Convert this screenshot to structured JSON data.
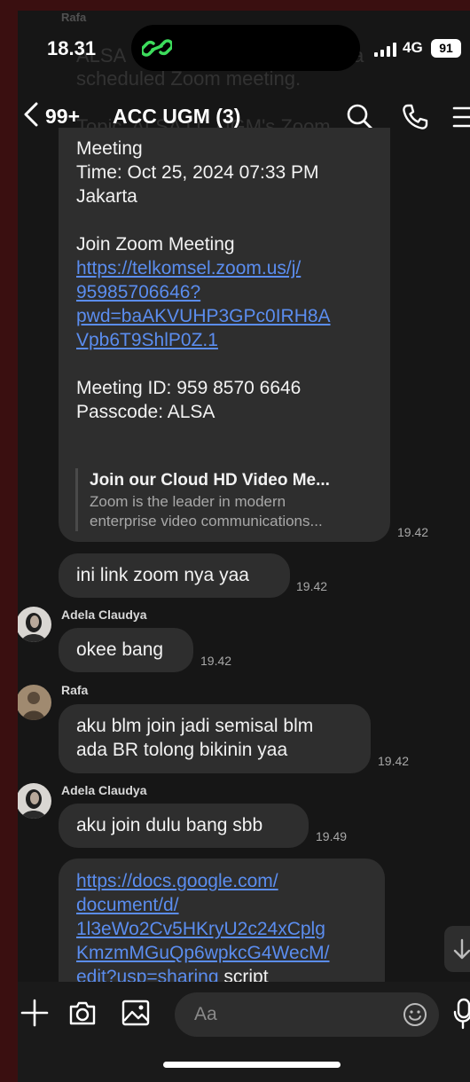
{
  "status_bar": {
    "time": "18.31",
    "network": "4G",
    "battery": "91"
  },
  "header": {
    "unread_count": "99+",
    "title": "ACC UGM (3)"
  },
  "ghost": {
    "sender": "Rafa",
    "line1": "ALSA",
    "line1b": "a",
    "line2": "scheduled Zoom meeting.",
    "line3": "Topic: ALSA LC UGM's Zoom"
  },
  "messages": {
    "m1": {
      "line_meeting": "Meeting",
      "line_time": "Time: Oct 25, 2024 07:33 PM",
      "line_tz": "Jakarta",
      "join_label": "Join Zoom Meeting",
      "link_lines": [
        "https://telkomsel.zoom.us/j/",
        "95985706646?",
        "pwd=baAKVUHP3GPc0IRH8A",
        "Vpb6T9ShlP0Z.1"
      ],
      "meeting_id": "Meeting ID: 959 8570 6646",
      "passcode": "Passcode: ALSA",
      "preview_title": "Join our Cloud HD Video Me...",
      "preview_desc1": "Zoom is the leader in modern",
      "preview_desc2": "enterprise video communications...",
      "time": "19.42"
    },
    "m2": {
      "text": "ini link zoom nya yaa",
      "time": "19.42"
    },
    "m3": {
      "sender": "Adela Claudya",
      "text": "okee bang",
      "time": "19.42"
    },
    "m4": {
      "sender": "Rafa",
      "line1": "aku blm join jadi semisal blm",
      "line2": "ada BR tolong bikinin yaa",
      "time": "19.42"
    },
    "m5": {
      "sender": "Adela Claudya",
      "text": "aku join dulu bang sbb",
      "time": "19.49"
    },
    "m6": {
      "link_lines": [
        "https://docs.google.com/",
        "document/d/",
        "1l3eWo2Cv5HKryU2c24xCplg",
        "KmzmMGuQp6wpkcG4WecM/",
        "edit?usp=sharing"
      ],
      "trailing_text": " script"
    }
  },
  "input": {
    "placeholder": "Aa"
  },
  "icons": {
    "back": "chevron-left-icon",
    "search": "search-icon",
    "call": "phone-icon",
    "menu": "menu-icon",
    "plus": "plus-icon",
    "camera": "camera-icon",
    "image": "image-icon",
    "emoji": "emoji-icon",
    "mic": "mic-icon",
    "scroll": "arrow-down-icon"
  },
  "colors": {
    "link": "#5b8def",
    "bubble": "#2e2e2e",
    "background": "#161616",
    "frame": "#3a0f10"
  }
}
